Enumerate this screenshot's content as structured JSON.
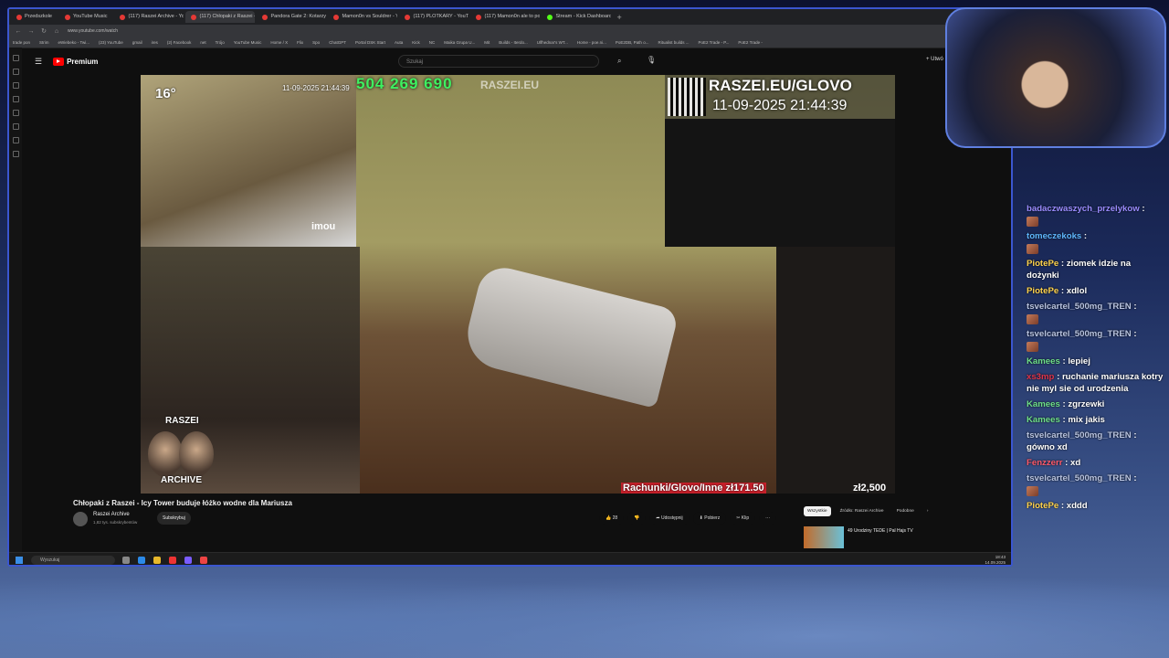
{
  "browser": {
    "tabs": [
      {
        "label": "Przedszkole"
      },
      {
        "label": "YouTube Music"
      },
      {
        "label": "(117) Raszei Archive - You"
      },
      {
        "label": "(117) Chłopaki z Raszei - Ic"
      },
      {
        "label": "Pandora Gate 2: Kotarzynu"
      },
      {
        "label": "Mamon0n vs Souldrer - Yo"
      },
      {
        "label": "(117) PLOTKARY - YouTube"
      },
      {
        "label": "(117) Mamon0n ale to popr"
      },
      {
        "label": "Stream - Kick Dashboard"
      }
    ],
    "new_tab": "+",
    "url": "www.youtube.com/watch",
    "bookmarks": [
      "trade pon",
      "Strim",
      "eWiebeko - Twi...",
      "(23) YouTube",
      "gmail",
      "ires",
      "(2) Facebook",
      "net",
      "Trójo",
      "YouTube Music",
      "Home / X",
      "Flix",
      "Spo",
      "ChatGPT",
      "Portal DSK Start",
      "Auta",
      "Kick",
      "NC",
      "Maika Grupa U...",
      "Mit",
      "Builds - Iterdo...",
      "Ulfhednar's WT...",
      "Home - poe.ni...",
      "PoE2DB, Path o...",
      "Ritualist builds ...",
      "PoE2 Trade - P...",
      "PoE2 Trade -"
    ]
  },
  "youtube": {
    "logo_text": "Premium",
    "search_placeholder": "Szukaj",
    "create_label": "+ Utwó",
    "video": {
      "temperature": "16°",
      "small_timestamp": "11-09-2025 21:44:39",
      "counter": "504 269 690",
      "watermark": "RASZEI.EU",
      "camera_brand": "imou",
      "promo": "RASZEI.EU/GLOVO",
      "big_timestamp": "11-09-2025 21:44:39",
      "badge_top": "RASZEI",
      "badge_bottom": "ARCHIVE",
      "bills_tag": "Rachunki/Glovo/Inne zł171.50",
      "money": "zł2,500"
    },
    "title": "Chłopaki z Raszei - Icy Tower buduje łóżko wodne dla Mariusza",
    "channel": {
      "name": "Raszei Archive",
      "subs": "1,82 tys. subskrybentów",
      "subscribe_label": "Subskrybuj"
    },
    "actions": {
      "likes": "28",
      "share": "Udostępnij",
      "download": "Pobierz",
      "clip": "Klip",
      "more": "···"
    },
    "chips": [
      "Wszystkie",
      "Źródło: Raszei Archive",
      "Podobne"
    ],
    "recommendation": {
      "title": "49 Urodziny TEDE | Pal Hajs TV"
    }
  },
  "taskbar": {
    "search_placeholder": "Wyszukaj",
    "time": "18:43",
    "date": "14.09.2025"
  },
  "chat": [
    {
      "user": "badaczwaszych_przelykow",
      "color": "#9b8cff",
      "text": "",
      "emote": true
    },
    {
      "user": "tomeczekoks",
      "color": "#5fb8ff",
      "text": "",
      "emote": true
    },
    {
      "user": "PiotePe",
      "color": "#ffd34d",
      "text": "ziomek idzie na dożynki",
      "emote": false
    },
    {
      "user": "PiotePe",
      "color": "#ffd34d",
      "text": "xdlol",
      "emote": false
    },
    {
      "user": "tsvelcartel_500mg_TREN",
      "color": "#b9c4e0",
      "text": "",
      "emote": true
    },
    {
      "user": "tsvelcartel_500mg_TREN",
      "color": "#b9c4e0",
      "text": "",
      "emote": true
    },
    {
      "user": "Kamees",
      "color": "#6fe08a",
      "text": "lepiej",
      "emote": false
    },
    {
      "user": "xs3mp",
      "color": "#e0344a",
      "text": "ruchanie mariusza kotry nie myl sie od urodzenia",
      "emote": false
    },
    {
      "user": "Kamees",
      "color": "#6fe08a",
      "text": "zgrzewki",
      "emote": false
    },
    {
      "user": "Kamees",
      "color": "#6fe08a",
      "text": "mix jakis",
      "emote": false
    },
    {
      "user": "tsvelcartel_500mg_TREN",
      "color": "#b9c4e0",
      "text": "gówno xd",
      "emote": false
    },
    {
      "user": "Fenzzerr",
      "color": "#ff5a6a",
      "text": "xd",
      "emote": false
    },
    {
      "user": "tsvelcartel_500mg_TREN",
      "color": "#b9c4e0",
      "text": "",
      "emote": true
    },
    {
      "user": "PiotePe",
      "color": "#ffd34d",
      "text": "xddd",
      "emote": false
    }
  ]
}
